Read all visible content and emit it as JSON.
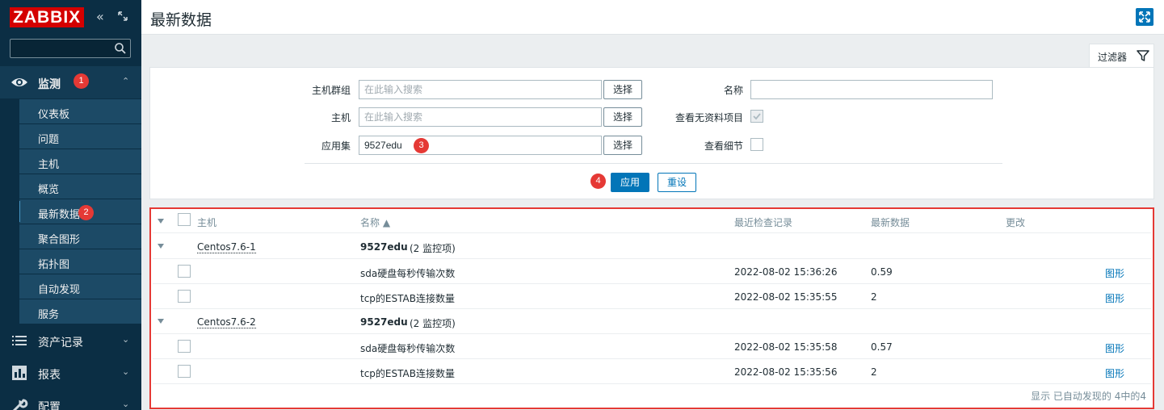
{
  "sidebar": {
    "logo": "ZABBIX",
    "collapse_icon": "double-chevron-left-icon",
    "kiosk_icon": "kiosk-mode-icon",
    "search_placeholder": "",
    "monitor": {
      "label": "监测",
      "badge": "1"
    },
    "sub_items": [
      {
        "label": "仪表板"
      },
      {
        "label": "问题"
      },
      {
        "label": "主机"
      },
      {
        "label": "概览"
      },
      {
        "label": "最新数据",
        "badge": "2",
        "active": true
      },
      {
        "label": "聚合图形"
      },
      {
        "label": "拓扑图"
      },
      {
        "label": "自动发现"
      },
      {
        "label": "服务"
      }
    ],
    "inventory": {
      "label": "资产记录"
    },
    "reports": {
      "label": "报表"
    },
    "config": {
      "label": "配置"
    }
  },
  "header": {
    "title": "最新数据"
  },
  "filter": {
    "tab_label": "过滤器",
    "host_group_label": "主机群组",
    "host_group_placeholder": "在此输入搜索",
    "host_label": "主机",
    "host_placeholder": "在此输入搜索",
    "app_label": "应用集",
    "app_value": "9527edu",
    "app_badge": "3",
    "select_label": "选择",
    "name_label": "名称",
    "name_value": "",
    "show_no_data_label": "查看无资料项目",
    "show_no_data_checked": true,
    "show_details_label": "查看细节",
    "show_details_checked": false,
    "apply_label": "应用",
    "apply_badge": "4",
    "reset_label": "重设"
  },
  "table": {
    "headers": {
      "host": "主机",
      "name": "名称 ▲",
      "last_check": "最近检查记录",
      "last_value": "最新数据",
      "change": "更改"
    },
    "groups": [
      {
        "host": "Centos7.6-1",
        "app": "9527edu",
        "app_count": "(2 监控项)",
        "rows": [
          {
            "name": "sda硬盘每秒传输次数",
            "last_check": "2022-08-02 15:36:26",
            "last_value": "0.59",
            "action": "图形"
          },
          {
            "name": "tcp的ESTAB连接数量",
            "last_check": "2022-08-02 15:35:55",
            "last_value": "2",
            "action": "图形"
          }
        ]
      },
      {
        "host": "Centos7.6-2",
        "app": "9527edu",
        "app_count": "(2 监控项)",
        "rows": [
          {
            "name": "sda硬盘每秒传输次数",
            "last_check": "2022-08-02 15:35:58",
            "last_value": "0.57",
            "action": "图形"
          },
          {
            "name": "tcp的ESTAB连接数量",
            "last_check": "2022-08-02 15:35:56",
            "last_value": "2",
            "action": "图形"
          }
        ]
      }
    ],
    "footer": "显示 已自动发现的 4中的4"
  },
  "colors": {
    "sidebar_bg": "#0b2e44",
    "accent": "#0275b8",
    "highlight": "#e53935"
  }
}
